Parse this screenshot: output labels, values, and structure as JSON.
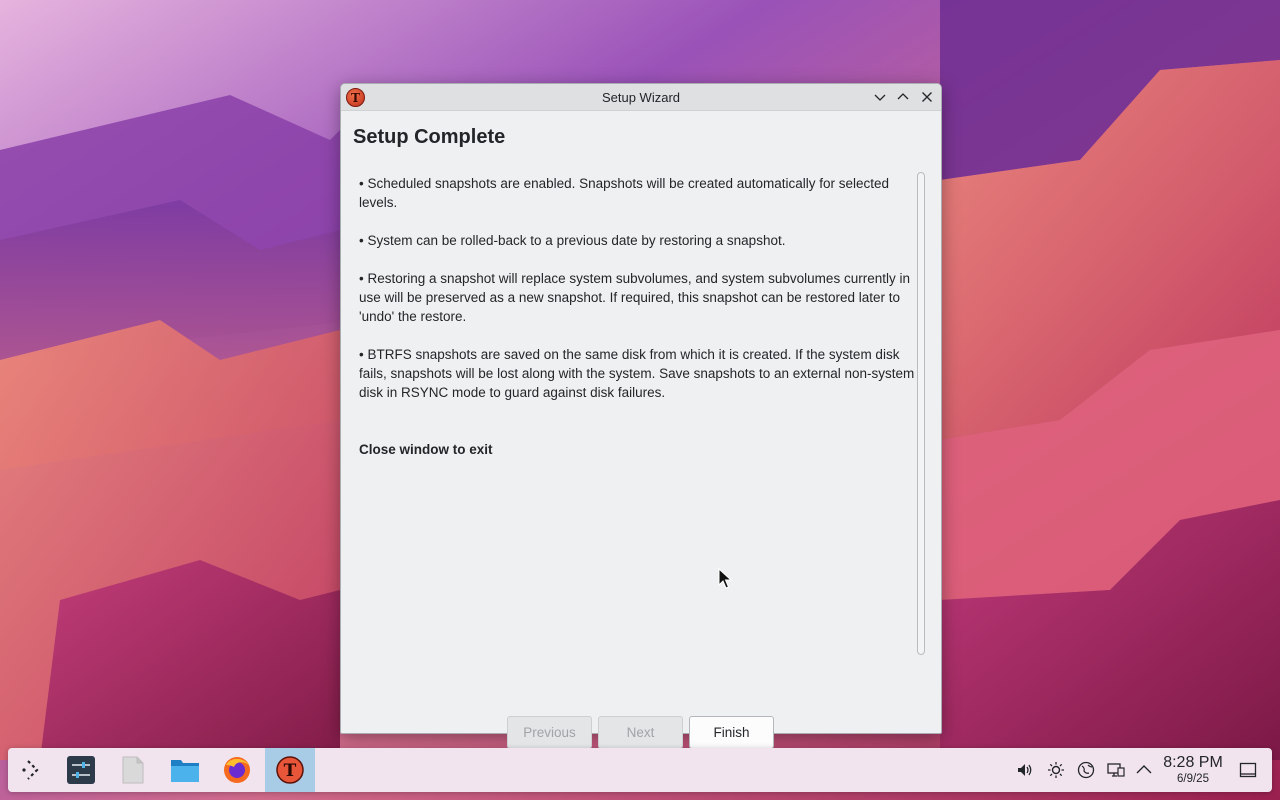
{
  "window": {
    "title": "Setup Wizard",
    "app_icon_glyph": "T",
    "controls": [
      "minimize-icon",
      "maximize-icon",
      "close-icon"
    ]
  },
  "page": {
    "title": "Setup Complete",
    "paragraphs": [
      "• Scheduled snapshots are enabled. Snapshots will be created automatically for selected levels.",
      "• System can be rolled-back to a previous date by restoring a snapshot.",
      "• Restoring a snapshot will replace system subvolumes, and system subvolumes currently in use will be preserved as a new snapshot. If required, this snapshot can be restored later to 'undo' the restore.",
      "• BTRFS snapshots are saved on the same disk from which it is created. If the system disk fails, snapshots will be lost along with the system. Save snapshots to an external non-system disk in RSYNC mode to guard against disk failures."
    ],
    "exit_note": "Close window to exit"
  },
  "buttons": {
    "previous": "Previous",
    "next": "Next",
    "finish": "Finish"
  },
  "taskbar": {
    "launchers": [
      "app-launcher-icon",
      "system-settings-icon",
      "blank-document-icon",
      "file-manager-icon",
      "firefox-icon",
      "timeshift-icon"
    ],
    "tray": [
      "volume-icon",
      "brightness-icon",
      "network-globe-icon",
      "display-icon",
      "show-hidden-chevron-icon"
    ],
    "clock_time": "8:28 PM",
    "clock_date": "6/9/25"
  },
  "colors": {
    "window_bg": "#eff0f1",
    "taskbar_bg": "#f2e4ef",
    "active_task": "#a8cbe6"
  }
}
